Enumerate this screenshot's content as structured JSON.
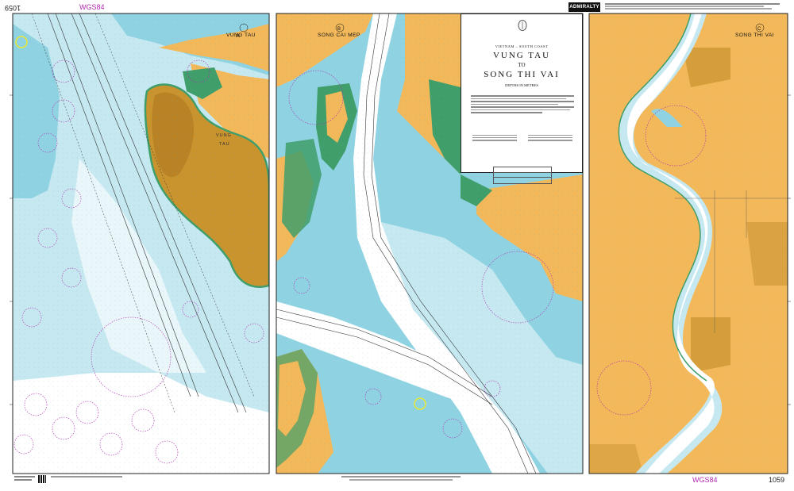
{
  "chart_number": "1059",
  "datum_label": "WGS84",
  "brand": "ADMIRALTY",
  "title_block": {
    "region": "VIETNAM – SOUTH COAST",
    "title_line1": "VUNG TAU",
    "title_connector": "TO",
    "title_line2": "SONG THI VAI",
    "depth_units": "DEPTHS IN METRES"
  },
  "panels": [
    {
      "letter": "A",
      "name": "VUNG TAU"
    },
    {
      "letter": "B",
      "name": "SONG CAI MEP"
    },
    {
      "letter": "C",
      "name": "SONG THI VAI"
    }
  ],
  "map_labels": {
    "vung": "VUNG",
    "tau": "TAU"
  },
  "colors": {
    "land": "#f2b85a",
    "land_dark": "#c9932e",
    "intertidal": "#3f9e6a",
    "shallow": "#8fd3e3",
    "mid": "#c6e8f1",
    "deep": "#ffffff",
    "magenta": "#b12ab0",
    "highlight": "#e8e830"
  },
  "icons": [
    "compass-rose-icon",
    "anchorage-circle-icon",
    "buoy-icon",
    "qr-code-icon",
    "crest-icon"
  ]
}
